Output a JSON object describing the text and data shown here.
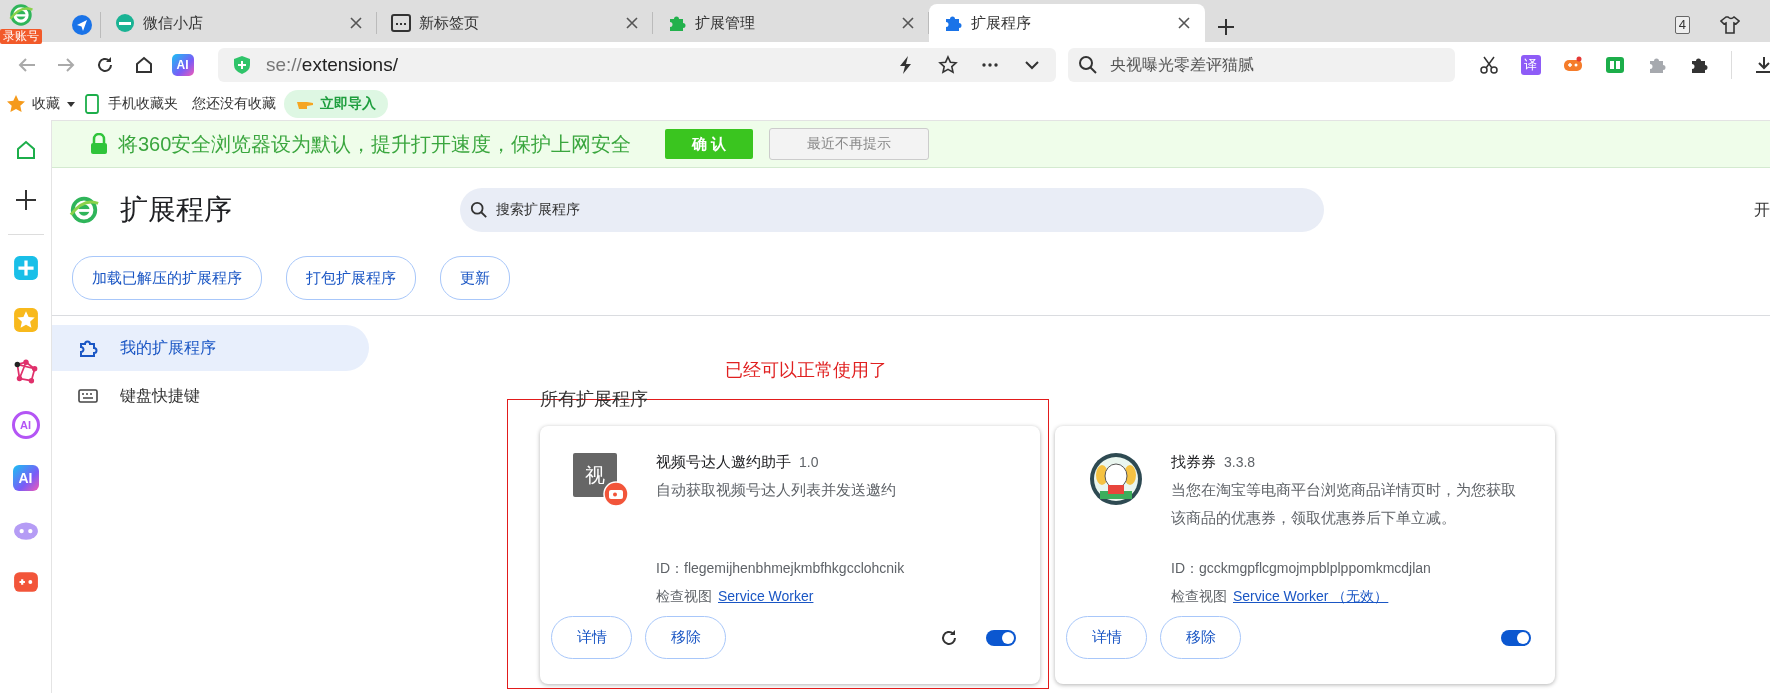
{
  "browser": {
    "account_badge": "录账号",
    "tabs": [
      {
        "kind": "shop",
        "label": "微信小店",
        "selected": false
      },
      {
        "kind": "newtab",
        "label": "新标签页",
        "selected": false
      },
      {
        "kind": "puzzle-green",
        "label": "扩展管理",
        "selected": false
      },
      {
        "kind": "puzzle-blue",
        "label": "扩展程序",
        "selected": true
      }
    ],
    "tab_count": "4",
    "toolbar": {
      "ai_label": "AI",
      "address_scheme": "se://",
      "address_path": "extensions/",
      "search_placeholder": "央视曝光零差评猫腻",
      "translate_label": "译"
    },
    "bookmarks": {
      "favorites": "收藏",
      "mobile": "手机收藏夹",
      "empty_note": "您还没有收藏",
      "import_button": "立即导入"
    },
    "rail": [
      {
        "kind": "home"
      },
      {
        "kind": "plus"
      },
      {
        "kind": "cross"
      },
      {
        "kind": "star"
      },
      {
        "kind": "graph"
      },
      {
        "kind": "ai-ring",
        "label": "AI"
      },
      {
        "kind": "ai",
        "label": "AI"
      },
      {
        "kind": "robot"
      },
      {
        "kind": "game"
      }
    ]
  },
  "banner": {
    "text": "将360安全浏览器设为默认，提升打开速度，保护上网安全",
    "confirm": "确 认",
    "dismiss": "最近不再提示"
  },
  "page": {
    "title": "扩展程序",
    "search_placeholder": "搜索扩展程序",
    "dev_mode_label": "开",
    "actions": [
      "加载已解压的扩展程序",
      "打包扩展程序",
      "更新"
    ],
    "nav": [
      {
        "kind": "extensions",
        "label": "我的扩展程序",
        "selected": true
      },
      {
        "kind": "keyboard",
        "label": "键盘快捷键",
        "selected": false
      }
    ],
    "annotation": "已经可以正常使用了",
    "section_title": "所有扩展程序",
    "extensions": [
      {
        "kind": "letter",
        "icon_text": "视",
        "name": "视频号达人邀约助手",
        "version": "1.0",
        "description": "自动获取视频号达人列表并发送邀约",
        "id": "ID：flegemijhenbhmejkmbfhkgcclohcnik",
        "inspect_label": "检查视图",
        "inspect_link": "Service Worker",
        "details_button": "详情",
        "remove_button": "移除",
        "reload": true,
        "enabled": true
      },
      {
        "kind": "mascot",
        "name": "找券券",
        "version": "3.3.8",
        "description": "当您在淘宝等电商平台浏览商品详情页时，为您获取该商品的优惠券，领取优惠券后下单立减。",
        "id": "ID：gcckmgpflcgmojmpblplppomkmcdjlan",
        "inspect_label": "检查视图",
        "inspect_link": "Service Worker （无效）",
        "details_button": "详情",
        "remove_button": "移除",
        "reload": false,
        "enabled": true
      }
    ]
  }
}
